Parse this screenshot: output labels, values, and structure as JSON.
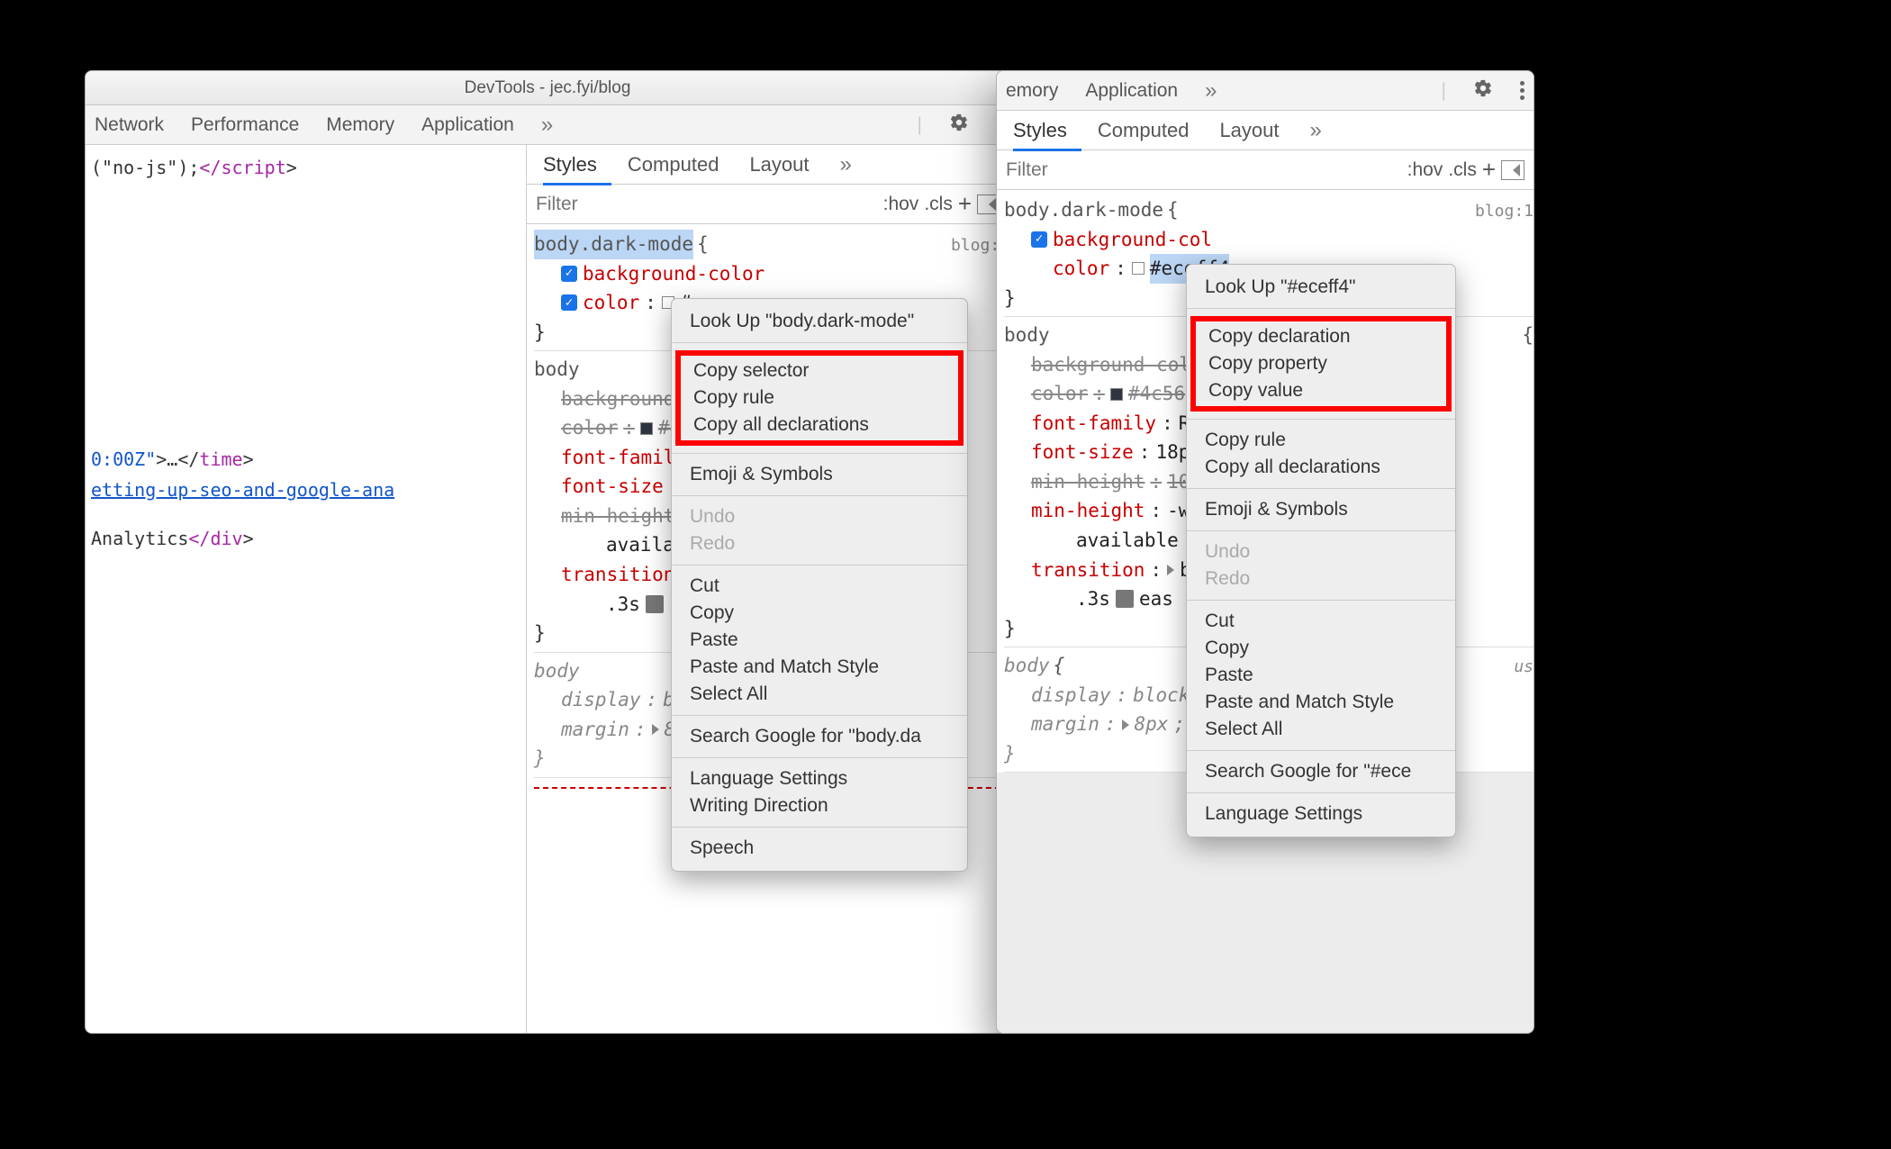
{
  "title": "DevTools - jec.fyi/blog",
  "mainTabs": {
    "network": "Network",
    "performance": "Performance",
    "memory": "Memory",
    "application": "Application"
  },
  "styTabs": {
    "styles": "Styles",
    "computed": "Computed",
    "layout": "Layout"
  },
  "filter": {
    "placeholder": "Filter",
    "hov": ":hov",
    "cls": ".cls"
  },
  "src": {
    "line1a": "(\"no-js\");",
    "line1b": "</script",
    "line1c": ">",
    "time1": "0:00Z\"",
    "time2": ">…</",
    "time3": "time",
    "time4": ">",
    "link": "etting-up-seo-and-google-ana",
    "ana": "Analytics",
    "divclose": "</",
    "divtag": "div",
    "divend": ">"
  },
  "rule1": {
    "selector": "body.dark-mode",
    "src": "blog:1",
    "bg": "background-color",
    "colLabel": "color",
    "colVal": "#eceff4",
    "colValCut": "#e"
  },
  "rule2": {
    "selector": "body",
    "bg": "background-color",
    "col": "color",
    "colv": "#4c56",
    "colvB": "#4",
    "ff": "font-family",
    "ffv": "R",
    "fs": "font-size",
    "fsv": "18p",
    "mh": "min-height",
    "mhv": "10",
    "mh2": "min-height",
    "mh2v": "-w",
    "avail": "available",
    "tr": "transition",
    "trv": "b",
    "trline": ".3s",
    "ease": "eas",
    "ea": "ea"
  },
  "rule3": {
    "selector": "body",
    "ua": "us",
    "disp": "display",
    "dispv": "block",
    "dispvB": "bl",
    "mar": "margin",
    "marv": "8px"
  },
  "menu1": {
    "lookup": "Look Up \"body.dark-mode\"",
    "c1": "Copy selector",
    "c2": "Copy rule",
    "c3": "Copy all declarations",
    "emoji": "Emoji & Symbols",
    "undo": "Undo",
    "redo": "Redo",
    "cut": "Cut",
    "copy": "Copy",
    "paste": "Paste",
    "pastem": "Paste and Match Style",
    "selall": "Select All",
    "search": "Search Google for \"body.da",
    "lang": "Language Settings",
    "wd": "Writing Direction",
    "sp": "Speech"
  },
  "menu2": {
    "lookup": "Look Up \"#eceff4\"",
    "c1": "Copy declaration",
    "c2": "Copy property",
    "c3": "Copy value",
    "crule": "Copy rule",
    "call": "Copy all declarations",
    "emoji": "Emoji & Symbols",
    "undo": "Undo",
    "redo": "Redo",
    "cut": "Cut",
    "copy": "Copy",
    "paste": "Paste",
    "pastem": "Paste and Match Style",
    "selall": "Select All",
    "search": "Search Google for \"#ece",
    "lang": "Language Settings"
  }
}
